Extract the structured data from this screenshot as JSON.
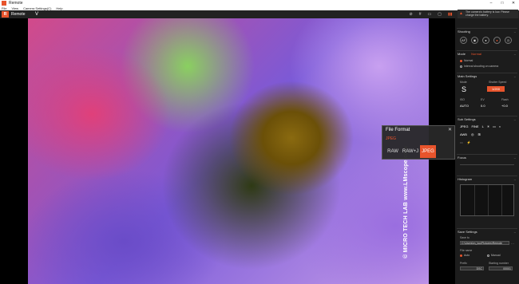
{
  "window": {
    "title": "Remote",
    "min": "–",
    "max": "□",
    "close": "✕"
  },
  "menu": [
    "File",
    "View",
    "Camera Settings(C)",
    "Help"
  ],
  "toolbar": {
    "logo": "R",
    "app_name": "Remote",
    "dropdown": "V"
  },
  "toolbar_icons": [
    "zoom",
    "grid",
    "display",
    "focus",
    "settings"
  ],
  "viewer": {
    "watermark": "© MICRO TECH LAB www.LMscope.com"
  },
  "file_format_popup": {
    "title": "File Format",
    "current": "JPEG",
    "options": [
      "RAW",
      "RAW+J",
      "JPEG"
    ],
    "selected_index": 2
  },
  "battery_warning": "The camera's battery is low. Please charge the battery.",
  "panel": {
    "shooting": {
      "title": "Shooting"
    },
    "mode": {
      "title": "Mode",
      "value": "Normal",
      "options": [
        "Normal",
        "Interval shooting on camera"
      ]
    },
    "main_settings": {
      "title": "Main Settings",
      "mode_label": "Mode",
      "mode_value": "S",
      "shutter_label": "Shutter Speed",
      "shutter_value": "1/200",
      "iso_label": "ISO",
      "ev_label": "EV",
      "flash_label": "Flash",
      "iso_value": "AUTO",
      "ev_value": "0.0",
      "flash_value": "+0.0"
    },
    "sub_settings": {
      "title": "Sub Settings"
    },
    "focus": {
      "title": "Focus"
    },
    "histogram": {
      "title": "Histogram"
    },
    "save_settings": {
      "title": "Save Settings",
      "save_to_label": "Save to",
      "save_to_value": "C:\\Users\\m_lou\\Pictures\\Remote",
      "file_name_label": "File name",
      "file_name_options": [
        "Auto",
        "Manual"
      ],
      "profile_label": "Prefix",
      "profile_value": "DSC",
      "start_label": "Starting number",
      "start_value": "00001"
    }
  }
}
